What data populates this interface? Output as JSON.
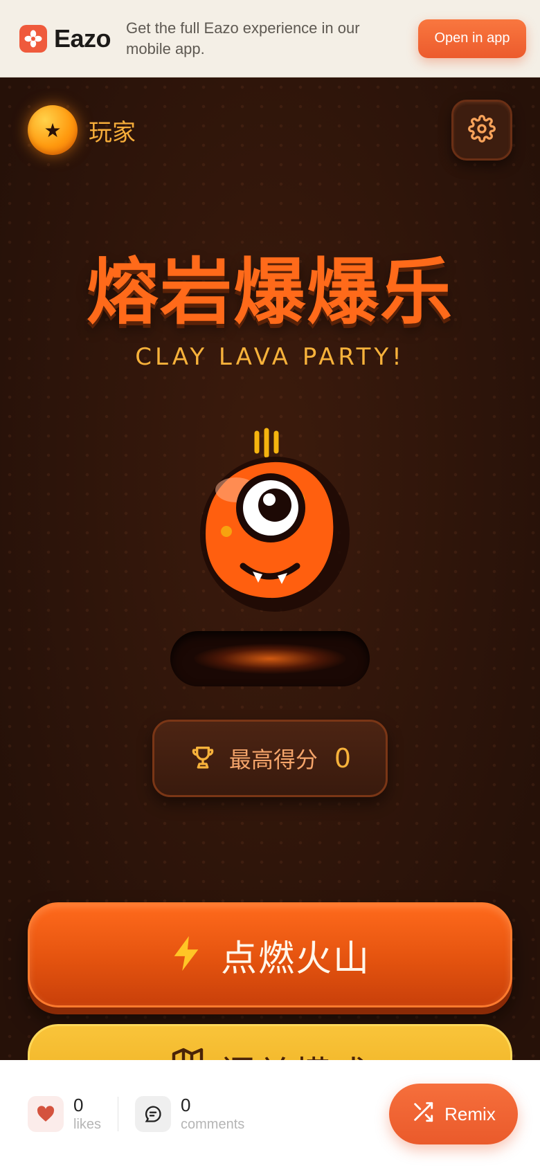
{
  "banner": {
    "brand": "Eazo",
    "message": "Get the full Eazo experience in our mobile app.",
    "open_label": "Open in app"
  },
  "player": {
    "name": "玩家",
    "avatar_glyph": "★"
  },
  "game": {
    "title_cn": "熔岩爆爆乐",
    "title_en": "CLAY LAVA PARTY!",
    "high_score_label": "最高得分",
    "high_score_value": "0",
    "ignite_label": "点燃火山",
    "level_mode_label": "闯关模式"
  },
  "social": {
    "likes_count": "0",
    "likes_label": "likes",
    "comments_count": "0",
    "comments_label": "comments",
    "remix_label": "Remix"
  },
  "colors": {
    "brand_accent": "#ef5a3c",
    "lava_orange": "#ff6a1a",
    "gold": "#f7b23b",
    "background": "#2c140a"
  },
  "icons": {
    "settings": "gear-icon",
    "high_score": "trophy-icon",
    "ignite": "lightning-icon",
    "level_mode": "map-icon",
    "likes": "heart-icon",
    "comments": "comment-icon",
    "remix": "shuffle-icon"
  }
}
